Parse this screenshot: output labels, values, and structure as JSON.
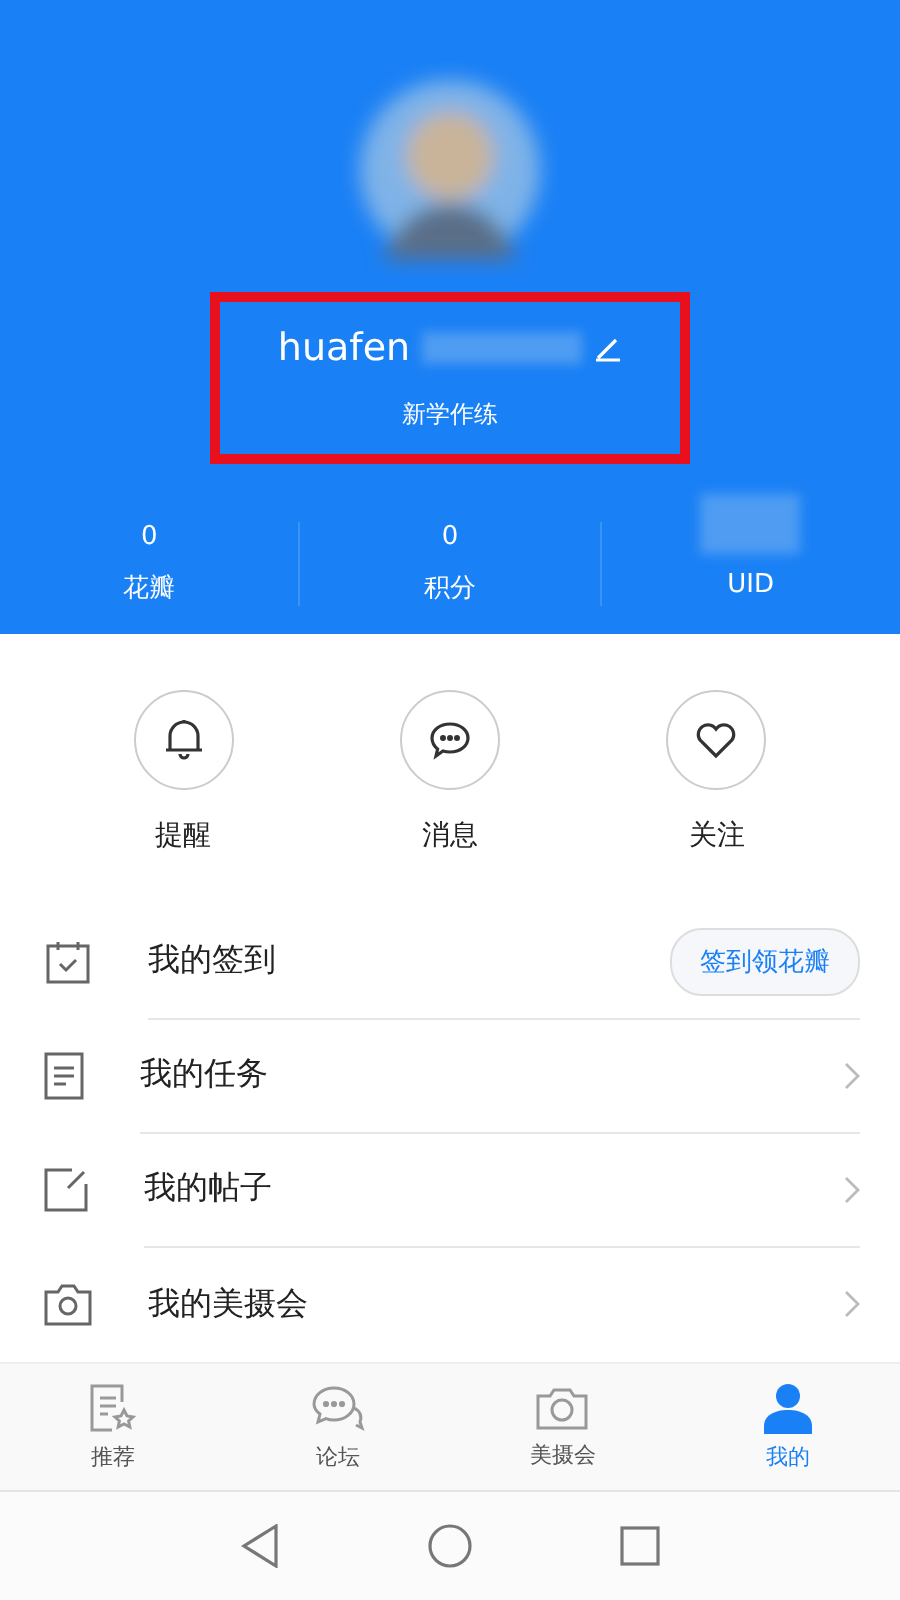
{
  "profile": {
    "username": "huafen",
    "subtitle": "新学作练",
    "highlighted": true
  },
  "stats": [
    {
      "value": "0",
      "label": "花瓣",
      "kind": "number"
    },
    {
      "value": "0",
      "label": "积分",
      "kind": "number"
    },
    {
      "label": "UID",
      "kind": "hidden"
    }
  ],
  "shortcuts": [
    {
      "label": "提醒",
      "kind": "bell"
    },
    {
      "label": "消息",
      "kind": "chat"
    },
    {
      "label": "关注",
      "kind": "heart"
    }
  ],
  "menu": [
    {
      "label": "我的签到",
      "kind": "checkin",
      "action": "签到领花瓣"
    },
    {
      "label": "我的任务",
      "kind": "task"
    },
    {
      "label": "我的帖子",
      "kind": "post"
    },
    {
      "label": "我的美摄会",
      "kind": "camera"
    }
  ],
  "tabs": [
    {
      "label": "推荐",
      "kind": "doc",
      "selected": false
    },
    {
      "label": "论坛",
      "kind": "chat",
      "selected": false
    },
    {
      "label": "美摄会",
      "kind": "camera",
      "selected": false
    },
    {
      "label": "我的",
      "kind": "user",
      "selected": true
    }
  ]
}
